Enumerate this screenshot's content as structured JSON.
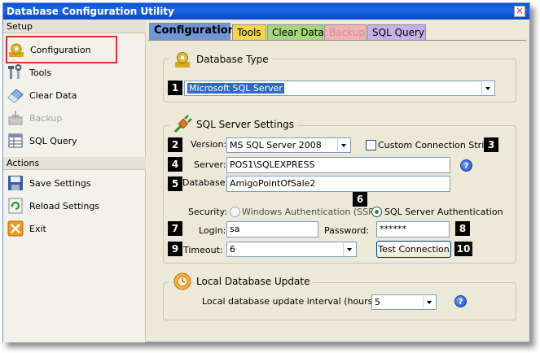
{
  "window": {
    "title": "Database Configuration Utility",
    "close_glyph": "✕"
  },
  "sidebar": {
    "setup_header": "Setup",
    "setup_items": [
      {
        "label": "Configuration",
        "icon": "gear-icon"
      },
      {
        "label": "Tools",
        "icon": "tools-icon"
      },
      {
        "label": "Clear Data",
        "icon": "eraser-icon"
      },
      {
        "label": "Backup",
        "icon": "backup-icon",
        "disabled": true
      },
      {
        "label": "SQL Query",
        "icon": "sql-query-icon"
      }
    ],
    "actions_header": "Actions",
    "action_items": [
      {
        "label": "Save Settings",
        "icon": "save-icon"
      },
      {
        "label": "Reload Settings",
        "icon": "reload-icon"
      },
      {
        "label": "Exit",
        "icon": "exit-icon"
      }
    ]
  },
  "tabs": [
    {
      "label": "Configuration",
      "color": "#6e97d6",
      "active": true
    },
    {
      "label": "Tools",
      "color": "#f5d54a"
    },
    {
      "label": "Clear Data",
      "color": "#a7d77d"
    },
    {
      "label": "Backup",
      "color": "#f4b3b3",
      "disabled": true
    },
    {
      "label": "SQL Query",
      "color": "#c5b1e8"
    }
  ],
  "database_type": {
    "title": "Database Type",
    "value": "Microsoft SQL Server",
    "badge": "1"
  },
  "sql_server_settings": {
    "title": "SQL Server Settings",
    "version_label": "Version:",
    "version_value": "MS SQL Server 2008",
    "custom_conn_label": "Custom Connection String",
    "server_label": "Server:",
    "server_value": "POS1\\SQLEXPRESS",
    "database_label": "Database:",
    "database_value": "AmigoPointOfSale2",
    "security_label": "Security:",
    "windows_auth_label": "Windows Authentication (SSPI)",
    "sql_auth_label": "SQL Server Authentication",
    "login_label": "Login:",
    "login_value": "sa",
    "password_label": "Password:",
    "password_value": "******",
    "timeout_label": "Timeout:",
    "timeout_value": "6",
    "test_button": "Test Connection",
    "help_glyph": "?",
    "badges": [
      "2",
      "3",
      "4",
      "5",
      "6",
      "7",
      "8",
      "9",
      "10"
    ]
  },
  "local_update": {
    "title": "Local Database Update",
    "interval_label": "Local database update interval (hours):",
    "interval_value": "5",
    "help_glyph": "?"
  },
  "colors": {
    "titlebar": "#0a52d8",
    "selection": "#316ac5",
    "highlight_border": "#e53030"
  }
}
